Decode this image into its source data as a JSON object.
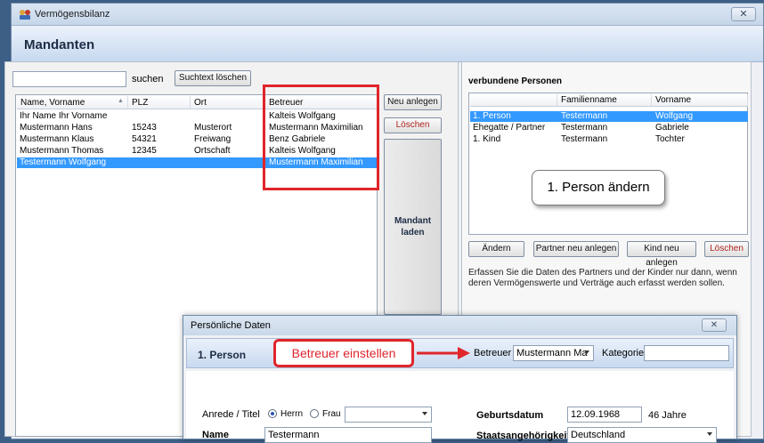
{
  "window": {
    "title": "Vermögensbilanz",
    "close_glyph": "✕"
  },
  "header": {
    "title": "Mandanten"
  },
  "search": {
    "value": "",
    "label": "suchen",
    "clear_button": "Suchtext löschen"
  },
  "clients_table": {
    "columns": [
      "Name, Vorname",
      "PLZ",
      "Ort",
      "Betreuer"
    ],
    "rows": [
      {
        "name": "Ihr Name Ihr Vorname",
        "plz": "",
        "ort": "",
        "betreuer": "Kalteis Wolfgang",
        "selected": false
      },
      {
        "name": "Mustermann Hans",
        "plz": "15243",
        "ort": "Musterort",
        "betreuer": "Mustermann Maximilian",
        "selected": false
      },
      {
        "name": "Mustermann Klaus",
        "plz": "54321",
        "ort": "Freiwang",
        "betreuer": "Benz Gabriele",
        "selected": false
      },
      {
        "name": "Mustermann Thomas",
        "plz": "12345",
        "ort": "Ortschaft",
        "betreuer": "Kalteis Wolfgang",
        "selected": false
      },
      {
        "name": "Testermann Wolfgang",
        "plz": "",
        "ort": "",
        "betreuer": "Mustermann Maximilian",
        "selected": true
      }
    ]
  },
  "client_actions": {
    "new": "Neu anlegen",
    "delete": "Löschen",
    "load": "Mandant\nladen"
  },
  "related": {
    "title": "verbundene Personen",
    "columns": [
      "",
      "Familienname",
      "Vorname"
    ],
    "rows": [
      {
        "role": "1. Person",
        "family": "Testermann",
        "first": "Wolfgang",
        "selected": true
      },
      {
        "role": "Ehegatte / Partner",
        "family": "Testermann",
        "first": "Gabriele",
        "selected": false
      },
      {
        "role": "1. Kind",
        "family": "Testermann",
        "first": "Tochter",
        "selected": false
      }
    ],
    "callout": "1. Person ändern",
    "buttons": {
      "edit": "Ändern",
      "partner": "Partner neu anlegen",
      "child": "Kind neu anlegen",
      "delete": "Löschen"
    },
    "info": "Erfassen Sie die Daten des Partners und der Kinder nur dann, wenn deren Vermögenswerte und Verträge auch erfasst werden sollen."
  },
  "dialog": {
    "title": "Persönliche Daten",
    "close_glyph": "✕",
    "person": "1. Person",
    "callout": "Betreuer einstellen",
    "betreuer_label": "Betreuer",
    "betreuer_value": "Mustermann Ma",
    "kategorie_label": "Kategorie",
    "kategorie_value": "",
    "anrede_label": "Anrede / Titel",
    "radio_herr": "Herrn",
    "radio_frau": "Frau",
    "title_value": "",
    "name_label": "Name",
    "name_value": "Testermann",
    "birth_label": "Geburtsdatum",
    "birth_value": "12.09.1968",
    "age": "46 Jahre",
    "nationality_label": "Staatsangehörigkeit",
    "nationality_value": "Deutschland"
  },
  "colors": {
    "accent_red": "#e0252b",
    "selection_blue": "#3399ff"
  }
}
